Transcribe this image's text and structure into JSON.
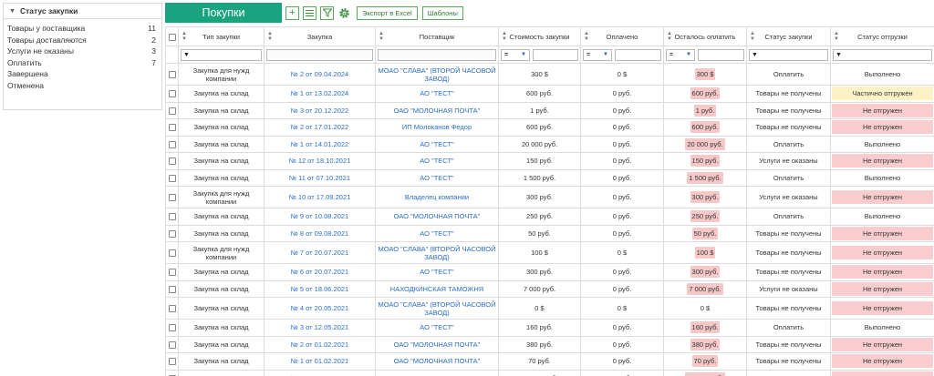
{
  "sidebar": {
    "title": "Статус закупки",
    "items": [
      {
        "label": "Товары у поставщика",
        "count": "11"
      },
      {
        "label": "Товары доставляются",
        "count": "2"
      },
      {
        "label": "Услуги не оказаны",
        "count": "3"
      },
      {
        "label": "Оплатить",
        "count": "7"
      },
      {
        "label": "Завершена",
        "count": ""
      },
      {
        "label": "Отменена",
        "count": ""
      }
    ]
  },
  "toolbar": {
    "title": "Покупки",
    "export_label": "Экспорт в Excel",
    "templates_label": "Шаблоны"
  },
  "table": {
    "columns": [
      "Тип закупки",
      "Закупка",
      "Поставщик",
      "Стоимость закупки",
      "Оплачено",
      "Осталось оплатить",
      "Статус закупки",
      "Статус отгрузки"
    ],
    "filter_ops": [
      "=",
      "=",
      "="
    ],
    "rows": [
      {
        "type": "Закупка для нужд компании",
        "purchase": "№ 2 от 09.04.2024",
        "supplier": "МОАО \"СЛАВА\" (ВТОРОЙ ЧАСОВОЙ ЗАВОД)",
        "cost": "300 $",
        "paid": "0 $",
        "left": "300 $",
        "left_hl": true,
        "pstatus": "Оплатить",
        "ship": "Выполнено",
        "ship_style": "none",
        "tall": true
      },
      {
        "type": "Закупка на склад",
        "purchase": "№ 1 от 13.02.2024",
        "supplier": "АО \"ТЕСТ\"",
        "cost": "600 руб.",
        "paid": "0 руб.",
        "left": "600 руб.",
        "left_hl": true,
        "pstatus": "Товары не получены",
        "ship": "Частично отгружен",
        "ship_style": "yel",
        "tall": false
      },
      {
        "type": "Закупка на склад",
        "purchase": "№ 3 от 20.12.2022",
        "supplier": "ОАО \"МОЛОЧНАЯ ПОЧТА\"",
        "cost": "1 руб.",
        "paid": "0 руб.",
        "left": "1 руб.",
        "left_hl": true,
        "pstatus": "Товары не получены",
        "ship": "Не отгружен",
        "ship_style": "red",
        "tall": false
      },
      {
        "type": "Закупка на склад",
        "purchase": "№ 2 от 17.01.2022",
        "supplier": "ИП Молоканов Федор",
        "cost": "600 руб.",
        "paid": "0 руб.",
        "left": "600 руб.",
        "left_hl": true,
        "pstatus": "Товары не получены",
        "ship": "Не отгружен",
        "ship_style": "red",
        "tall": false
      },
      {
        "type": "Закупка на склад",
        "purchase": "№ 1 от 14.01.2022",
        "supplier": "АО \"ТЕСТ\"",
        "cost": "20 000 руб.",
        "paid": "0 руб.",
        "left": "20 000 руб.",
        "left_hl": true,
        "pstatus": "Оплатить",
        "ship": "Выполнено",
        "ship_style": "none",
        "tall": false
      },
      {
        "type": "Закупка на склад",
        "purchase": "№ 12 от 18.10.2021",
        "supplier": "АО \"ТЕСТ\"",
        "cost": "150 руб.",
        "paid": "0 руб.",
        "left": "150 руб.",
        "left_hl": true,
        "pstatus": "Услуги не оказаны",
        "ship": "Не отгружен",
        "ship_style": "red",
        "tall": false
      },
      {
        "type": "Закупка на склад",
        "purchase": "№ 11 от 07.10.2021",
        "supplier": "АО \"ТЕСТ\"",
        "cost": "1 500 руб.",
        "paid": "0 руб.",
        "left": "1 500 руб.",
        "left_hl": true,
        "pstatus": "Оплатить",
        "ship": "Выполнено",
        "ship_style": "none",
        "tall": false
      },
      {
        "type": "Закупка для нужд компании",
        "purchase": "№ 10 от 17.09.2021",
        "supplier": "Владелец компании",
        "cost": "300 руб.",
        "paid": "0 руб.",
        "left": "300 руб.",
        "left_hl": true,
        "pstatus": "Услуги не оказаны",
        "ship": "Не отгружен",
        "ship_style": "red",
        "tall": true
      },
      {
        "type": "Закупка на склад",
        "purchase": "№ 9 от 10.08.2021",
        "supplier": "ОАО \"МОЛОЧНАЯ ПОЧТА\"",
        "cost": "250 руб.",
        "paid": "0 руб.",
        "left": "250 руб.",
        "left_hl": true,
        "pstatus": "Оплатить",
        "ship": "Выполнено",
        "ship_style": "none",
        "tall": false
      },
      {
        "type": "Закупка на склад",
        "purchase": "№ 8 от 09.08.2021",
        "supplier": "АО \"ТЕСТ\"",
        "cost": "50 руб.",
        "paid": "0 руб.",
        "left": "50 руб.",
        "left_hl": true,
        "pstatus": "Товары не получены",
        "ship": "Не отгружен",
        "ship_style": "red",
        "tall": false
      },
      {
        "type": "Закупка для нужд компании",
        "purchase": "№ 7 от 20.07.2021",
        "supplier": "МОАО \"СЛАВА\" (ВТОРОЙ ЧАСОВОЙ ЗАВОД)",
        "cost": "100 $",
        "paid": "0 $",
        "left": "100 $",
        "left_hl": true,
        "pstatus": "Товары не получены",
        "ship": "Не отгружен",
        "ship_style": "red",
        "tall": true
      },
      {
        "type": "Закупка на склад",
        "purchase": "№ 6 от 20.07.2021",
        "supplier": "АО \"ТЕСТ\"",
        "cost": "300 руб.",
        "paid": "0 руб.",
        "left": "300 руб.",
        "left_hl": true,
        "pstatus": "Товары не получены",
        "ship": "Не отгружен",
        "ship_style": "red",
        "tall": false
      },
      {
        "type": "Закупка на склад",
        "purchase": "№ 5 от 18.06.2021",
        "supplier": "НАХОДКИНСКАЯ ТАМОЖНЯ",
        "cost": "7 000 руб.",
        "paid": "0 руб.",
        "left": "7 000 руб.",
        "left_hl": true,
        "pstatus": "Услуги не оказаны",
        "ship": "Не отгружен",
        "ship_style": "red",
        "tall": false
      },
      {
        "type": "Закупка на склад",
        "purchase": "№ 4 от 20.05.2021",
        "supplier": "МОАО \"СЛАВА\" (ВТОРОЙ ЧАСОВОЙ ЗАВОД)",
        "cost": "0 $",
        "paid": "0 $",
        "left": "0 $",
        "left_hl": false,
        "pstatus": "Товары не получены",
        "ship": "Не отгружен",
        "ship_style": "red",
        "tall": true
      },
      {
        "type": "Закупка на склад",
        "purchase": "№ 3 от 12.05.2021",
        "supplier": "АО \"ТЕСТ\"",
        "cost": "160 руб.",
        "paid": "0 руб.",
        "left": "160 руб.",
        "left_hl": true,
        "pstatus": "Оплатить",
        "ship": "Выполнено",
        "ship_style": "none",
        "tall": false
      },
      {
        "type": "Закупка на склад",
        "purchase": "№ 2 от 01.02.2021",
        "supplier": "ОАО \"МОЛОЧНАЯ ПОЧТА\"",
        "cost": "380 руб.",
        "paid": "0 руб.",
        "left": "380 руб.",
        "left_hl": true,
        "pstatus": "Товары не получены",
        "ship": "Не отгружен",
        "ship_style": "red",
        "tall": false
      },
      {
        "type": "Закупка на склад",
        "purchase": "№ 1 от 01.02.2021",
        "supplier": "ОАО \"МОЛОЧНАЯ ПОЧТА\"",
        "cost": "70 руб.",
        "paid": "0 руб.",
        "left": "70 руб.",
        "left_hl": true,
        "pstatus": "Товары не получены",
        "ship": "Не отгружен",
        "ship_style": "red",
        "tall": false
      },
      {
        "type": "Закупка на склад",
        "purchase": "№ 6 от 24.12.2020",
        "supplier": "АО \"ТЕСТ\"",
        "cost": "15 000 руб.",
        "paid": "0 руб.",
        "left": "15 000 руб.",
        "left_hl": true,
        "pstatus": "Товары не получены",
        "ship": "Не отгружен",
        "ship_style": "red",
        "tall": false
      }
    ]
  }
}
